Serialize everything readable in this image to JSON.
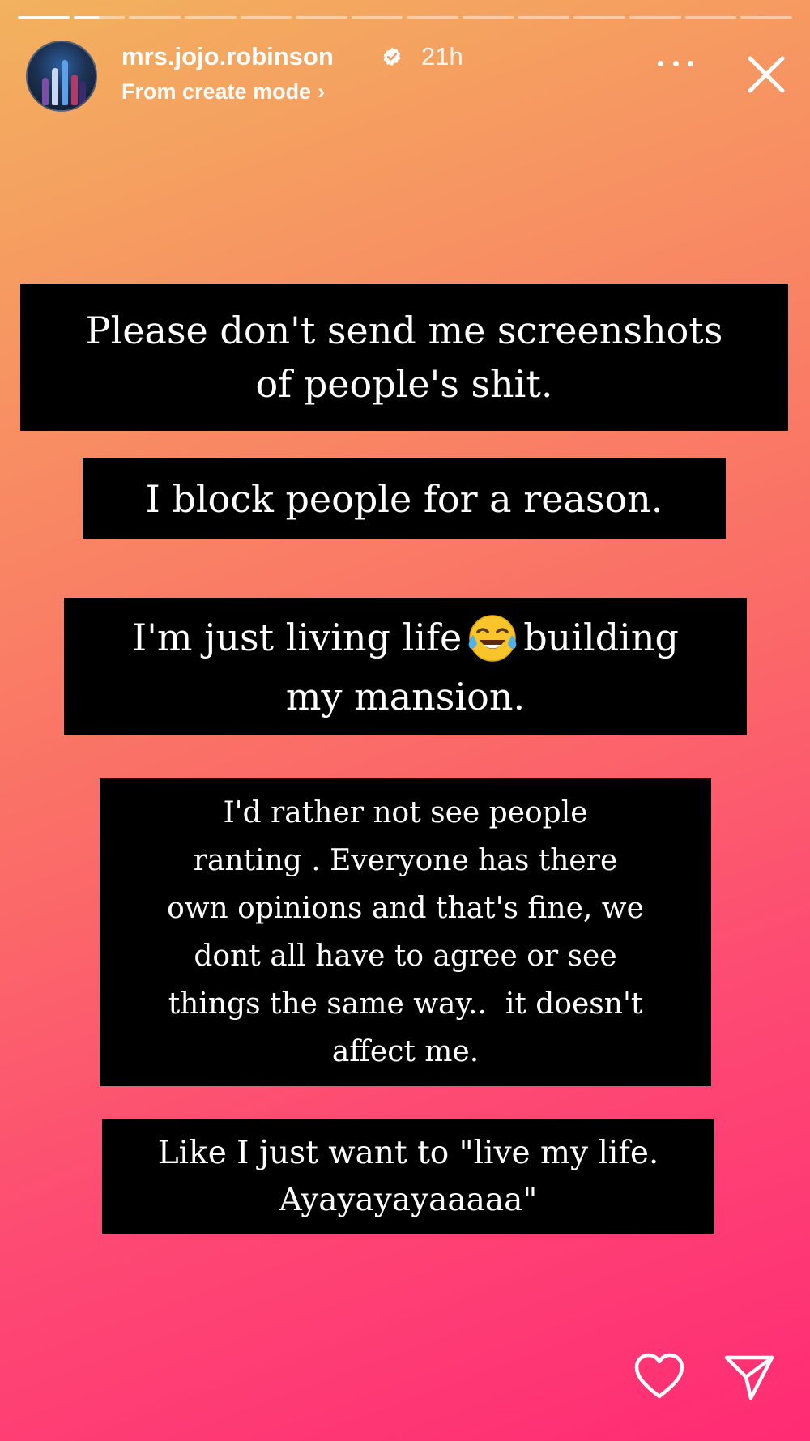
{
  "progress": {
    "segments": 14,
    "completed": 1,
    "current_fraction": 0.5
  },
  "header": {
    "username": "mrs.jojo.robinson",
    "verified": true,
    "time_ago": "21h",
    "subtitle": "From create mode",
    "subtitle_chevron": "›"
  },
  "icons": {
    "verified": "verified-badge-icon",
    "more": "more-options-icon",
    "close": "close-icon",
    "emoji": "face-with-tears-of-joy-emoji",
    "like": "heart-icon",
    "share": "paper-plane-icon"
  },
  "story": {
    "box1": {
      "line1": "Please don't send me screenshots",
      "line2": "of people's shit."
    },
    "box2": {
      "line1": "I block people for a reason."
    },
    "box3": {
      "line1_before": "I'm just living life",
      "emoji": "😂",
      "line1_after": "building",
      "line2": "my mansion."
    },
    "box4": {
      "line1": "I'd rather not see people",
      "line2": "ranting . Everyone has there",
      "line3": "own opinions and that's fine, we",
      "line4": "dont all have to agree or see",
      "line5": "things the same way..  it doesn't",
      "line6": "affect me."
    },
    "box5": {
      "line1": "Like I just want to \"live my life.",
      "line2": "Ayayayayaaaaa\""
    }
  },
  "colors": {
    "gradient_top": "#f2b25e",
    "gradient_mid": "#fb6a68",
    "gradient_bottom": "#ff2b74",
    "text_box_bg": "#000000",
    "text": "#ffffff"
  }
}
